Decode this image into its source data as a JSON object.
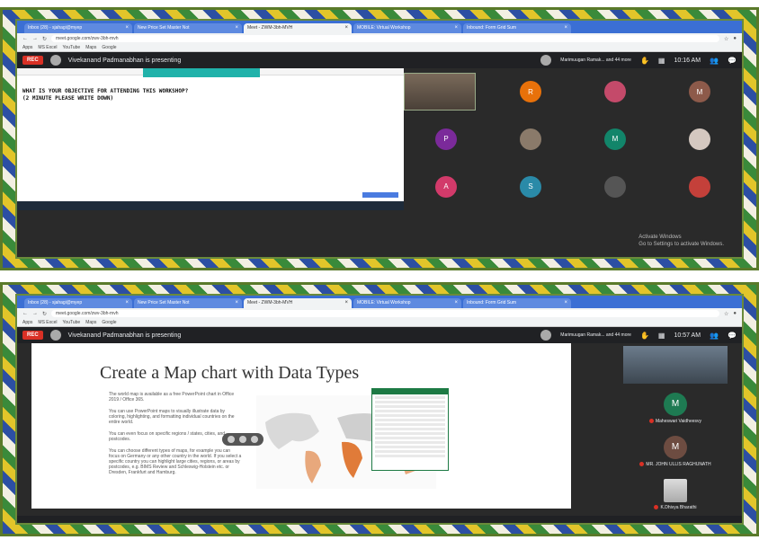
{
  "top": {
    "tabs": [
      {
        "label": "Inbox (28) - sjahagi@myep",
        "active": false
      },
      {
        "label": "New Price Set Master Not",
        "active": false
      },
      {
        "label": "Meet - ZWM-3bh-MVH",
        "active": true
      },
      {
        "label": "MOBILE: Virtual Workshop",
        "active": false
      },
      {
        "label": "Inbound: Form Grid Sum",
        "active": false
      }
    ],
    "url": "meet.google.com/zwv-3bh-mvh",
    "bookmarks": [
      "Apps",
      "MS Excel",
      "YouTube",
      "Maps",
      "Google"
    ],
    "rec_label": "REC",
    "presenting": "Vivekanand Padmanabhan is presenting",
    "people_label": "Marimuugan Ramak... and 44 more",
    "time": "10:16 AM",
    "document_lines": [
      "WHAT IS YOUR OBJECTIVE FOR ATTENDING THIS WORKSHOP?",
      "(2 MINUTE PLEASE WRITE DOWN)"
    ],
    "participants": [
      {
        "kind": "video"
      },
      {
        "initial": "R",
        "color": "#e8710a"
      },
      {
        "initial": "",
        "color": "#c44a6a"
      },
      {
        "initial": "M",
        "color": "#8d5a4a"
      },
      {
        "initial": "P",
        "color": "#7b2a9a"
      },
      {
        "initial": "",
        "color": "#8a7a6a"
      },
      {
        "initial": "M",
        "color": "#12856a"
      },
      {
        "initial": "",
        "color": "#d4c8c0"
      },
      {
        "initial": "A",
        "color": "#d23a6a"
      },
      {
        "initial": "S",
        "color": "#2a8aa8"
      },
      {
        "initial": "",
        "color": "#555"
      },
      {
        "initial": "",
        "color": "#c4403a"
      }
    ],
    "activate_line1": "Activate Windows",
    "activate_line2": "Go to Settings to activate Windows."
  },
  "bottom": {
    "tabs": [
      {
        "label": "Inbox (28) - sjahagi@myep",
        "active": false
      },
      {
        "label": "New Price Set Master Not",
        "active": false
      },
      {
        "label": "Meet - ZWM-3bh-MVH",
        "active": true
      },
      {
        "label": "MOBILE: Virtual Workshop",
        "active": false
      },
      {
        "label": "Inbound: Form Grid Sum",
        "active": false
      }
    ],
    "url": "meet.google.com/zwv-3bh-mvh",
    "bookmarks": [
      "Apps",
      "MS Excel",
      "YouTube",
      "Maps",
      "Google"
    ],
    "rec_label": "REC",
    "presenting": "Vivekanand Padmanabhan is presenting",
    "people_label": "Marimuugan Ramak... and 44 more",
    "time": "10:57 AM",
    "slide_title": "Create a Map chart with Data Types",
    "slide_paragraphs": [
      "The world map is available as a free PowerPoint chart in Office 2019 / Office 365.",
      "You can use PowerPoint maps to visually illustrate data by coloring, highlighting, and formatting individual countries on the entire world.",
      "You can even focus on specific regions / states, cities, and postcodes.",
      "You can choose different types of maps, for example you can focus on Germany or any other country in the world. If you select a specific country you can highlight large cities, regions, or areas by postcodes, e.g. BIMS Review and Schleswig-Holstein etc. or Dresden, Frankfurt and Hamburg."
    ],
    "side_participants": [
      {
        "kind": "video",
        "name": ""
      },
      {
        "kind": "avatar",
        "initial": "M",
        "color": "#1e7a52",
        "name": "Maheswari Vaidheesvy"
      },
      {
        "kind": "avatar",
        "initial": "M",
        "color": "#6d4c41",
        "name": "MR. JOHN ULLIS RAGHUNATH"
      },
      {
        "kind": "photo",
        "initial": "",
        "name": "K.Dhivya Bharathi"
      }
    ]
  }
}
